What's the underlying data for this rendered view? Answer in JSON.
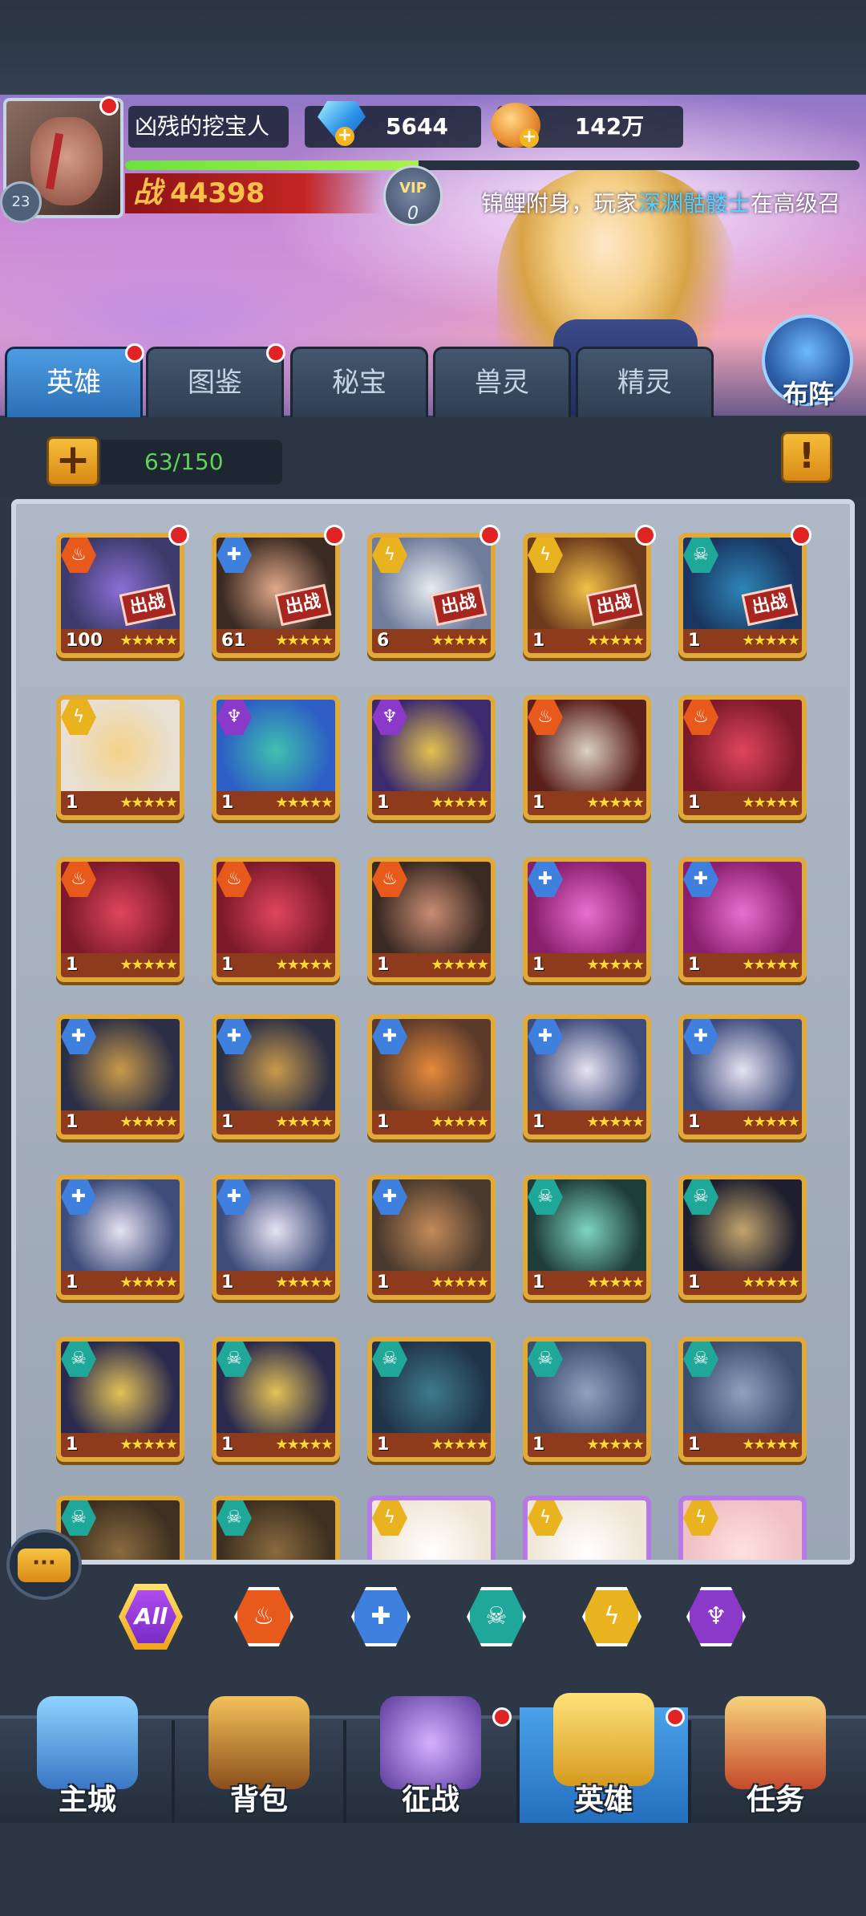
{
  "profile": {
    "name": "凶残的挖宝人",
    "level": "23",
    "power_label": "战",
    "power_value": "44398",
    "vip_label": "VIP",
    "vip_level": "0",
    "exp_progress": 0.4
  },
  "currency": {
    "gems": "5644",
    "gold": "142万"
  },
  "marquee": {
    "prefix": "锦鲤附身，玩家",
    "player": "深渊骷髅士",
    "suffix": "在高级召"
  },
  "tabs": [
    {
      "label": "英雄",
      "active": true,
      "dot": true
    },
    {
      "label": "图鉴",
      "active": false,
      "dot": true
    },
    {
      "label": "秘宝",
      "active": false,
      "dot": false
    },
    {
      "label": "兽灵",
      "active": false,
      "dot": false
    },
    {
      "label": "精灵",
      "active": false,
      "dot": false
    }
  ],
  "formation_label": "布阵",
  "hero_count": "63/150",
  "add_label": "+",
  "info_label": "!",
  "deploy_tag": "出战",
  "star_glyph": "★★★★★",
  "heroes": [
    {
      "faction": "fire",
      "level": "100",
      "deployed": true,
      "dot": true,
      "art": [
        "#3c3a6a",
        "#8a6fd6"
      ]
    },
    {
      "faction": "water",
      "level": "61",
      "deployed": true,
      "dot": true,
      "art": [
        "#3a2a22",
        "#e0a889"
      ]
    },
    {
      "faction": "light",
      "level": "6",
      "deployed": true,
      "dot": true,
      "art": [
        "#6f7c9a",
        "#e7ecf2"
      ]
    },
    {
      "faction": "light",
      "level": "1",
      "deployed": true,
      "dot": true,
      "art": [
        "#6b3a1c",
        "#f2c14a"
      ]
    },
    {
      "faction": "nature",
      "level": "1",
      "deployed": true,
      "dot": true,
      "art": [
        "#1a3560",
        "#2d86b8"
      ]
    },
    {
      "faction": "light",
      "level": "1",
      "deployed": false,
      "dot": false,
      "art": [
        "#e9e0d3",
        "#f4d28a"
      ]
    },
    {
      "faction": "dark",
      "level": "1",
      "deployed": false,
      "dot": false,
      "art": [
        "#2d5fc4",
        "#3fc0b0"
      ]
    },
    {
      "faction": "dark",
      "level": "1",
      "deployed": false,
      "dot": false,
      "art": [
        "#3d2a6e",
        "#e2c24e"
      ]
    },
    {
      "faction": "fire",
      "level": "1",
      "deployed": false,
      "dot": false,
      "art": [
        "#5a1f1a",
        "#dcd0c4"
      ]
    },
    {
      "faction": "fire",
      "level": "1",
      "deployed": false,
      "dot": false,
      "art": [
        "#7c1a2a",
        "#e0455c"
      ]
    },
    {
      "faction": "fire",
      "level": "1",
      "deployed": false,
      "dot": false,
      "art": [
        "#7c1a2a",
        "#e0455c"
      ]
    },
    {
      "faction": "fire",
      "level": "1",
      "deployed": false,
      "dot": false,
      "art": [
        "#7c1a2a",
        "#e0455c"
      ]
    },
    {
      "faction": "fire",
      "level": "1",
      "deployed": false,
      "dot": false,
      "art": [
        "#3a2a22",
        "#c98c74"
      ]
    },
    {
      "faction": "water",
      "level": "1",
      "deployed": false,
      "dot": false,
      "art": [
        "#8a1f6e",
        "#e86fd0"
      ]
    },
    {
      "faction": "water",
      "level": "1",
      "deployed": false,
      "dot": false,
      "art": [
        "#8a1f6e",
        "#e86fd0"
      ]
    },
    {
      "faction": "water",
      "level": "1",
      "deployed": false,
      "dot": false,
      "art": [
        "#2b2f45",
        "#c99a4b"
      ]
    },
    {
      "faction": "water",
      "level": "1",
      "deployed": false,
      "dot": false,
      "art": [
        "#2b2f45",
        "#c99a4b"
      ]
    },
    {
      "faction": "water",
      "level": "1",
      "deployed": false,
      "dot": false,
      "art": [
        "#5b3a2a",
        "#e58a3c"
      ]
    },
    {
      "faction": "water",
      "level": "1",
      "deployed": false,
      "dot": false,
      "art": [
        "#3e4c7a",
        "#e6e2f2"
      ]
    },
    {
      "faction": "water",
      "level": "1",
      "deployed": false,
      "dot": false,
      "art": [
        "#3e4c7a",
        "#e6e2f2"
      ]
    },
    {
      "faction": "water",
      "level": "1",
      "deployed": false,
      "dot": false,
      "art": [
        "#3e4c7a",
        "#e6e2f2"
      ]
    },
    {
      "faction": "water",
      "level": "1",
      "deployed": false,
      "dot": false,
      "art": [
        "#3e4c7a",
        "#e6e2f2"
      ]
    },
    {
      "faction": "water",
      "level": "1",
      "deployed": false,
      "dot": false,
      "art": [
        "#4a3a2e",
        "#c48a5a"
      ]
    },
    {
      "faction": "nature",
      "level": "1",
      "deployed": false,
      "dot": false,
      "art": [
        "#1f3d38",
        "#7ed4c2"
      ]
    },
    {
      "faction": "nature",
      "level": "1",
      "deployed": false,
      "dot": false,
      "art": [
        "#1e1e2e",
        "#c2a46e"
      ]
    },
    {
      "faction": "nature",
      "level": "1",
      "deployed": false,
      "dot": false,
      "art": [
        "#2a2a4e",
        "#e3c256"
      ]
    },
    {
      "faction": "nature",
      "level": "1",
      "deployed": false,
      "dot": false,
      "art": [
        "#2a2a4e",
        "#e3c256"
      ]
    },
    {
      "faction": "nature",
      "level": "1",
      "deployed": false,
      "dot": false,
      "art": [
        "#21354a",
        "#3e7a8c"
      ]
    },
    {
      "faction": "nature",
      "level": "1",
      "deployed": false,
      "dot": false,
      "art": [
        "#3d4e6e",
        "#8fa2bf"
      ]
    },
    {
      "faction": "nature",
      "level": "1",
      "deployed": false,
      "dot": false,
      "art": [
        "#3d4e6e",
        "#8fa2bf"
      ]
    },
    {
      "faction": "nature",
      "level": "",
      "deployed": false,
      "dot": false,
      "art": [
        "#3d3020",
        "#8a6a40"
      ],
      "partial": true
    },
    {
      "faction": "nature",
      "level": "",
      "deployed": false,
      "dot": false,
      "art": [
        "#3d3020",
        "#8a6a40"
      ],
      "partial": true
    },
    {
      "faction": "light",
      "level": "",
      "deployed": false,
      "dot": false,
      "art": [
        "#f0e6d6",
        "#ffffff"
      ],
      "partial": true,
      "purple": true
    },
    {
      "faction": "light",
      "level": "",
      "deployed": false,
      "dot": false,
      "art": [
        "#f0e6d6",
        "#ffffff"
      ],
      "partial": true,
      "purple": true
    },
    {
      "faction": "light",
      "level": "",
      "deployed": false,
      "dot": false,
      "art": [
        "#f0c0c4",
        "#ffe0e0"
      ],
      "partial": true,
      "purple": true
    }
  ],
  "filters": [
    {
      "name": "all",
      "label": "All"
    },
    {
      "name": "fire",
      "color": "#e8591c"
    },
    {
      "name": "water",
      "color": "#3f7fde"
    },
    {
      "name": "nature",
      "color": "#1fa79a"
    },
    {
      "name": "light",
      "color": "#e9b320"
    },
    {
      "name": "dark",
      "color": "#8a39c9"
    }
  ],
  "chat_label": "···",
  "nav": [
    {
      "label": "主城",
      "dot": false,
      "active": false
    },
    {
      "label": "背包",
      "dot": false,
      "active": false
    },
    {
      "label": "征战",
      "dot": true,
      "active": false
    },
    {
      "label": "英雄",
      "dot": true,
      "active": true
    },
    {
      "label": "任务",
      "dot": false,
      "active": false
    }
  ],
  "faction_glyphs": {
    "fire": "♨",
    "water": "✚",
    "light": "ϟ",
    "dark": "♆",
    "nature": "☠"
  }
}
